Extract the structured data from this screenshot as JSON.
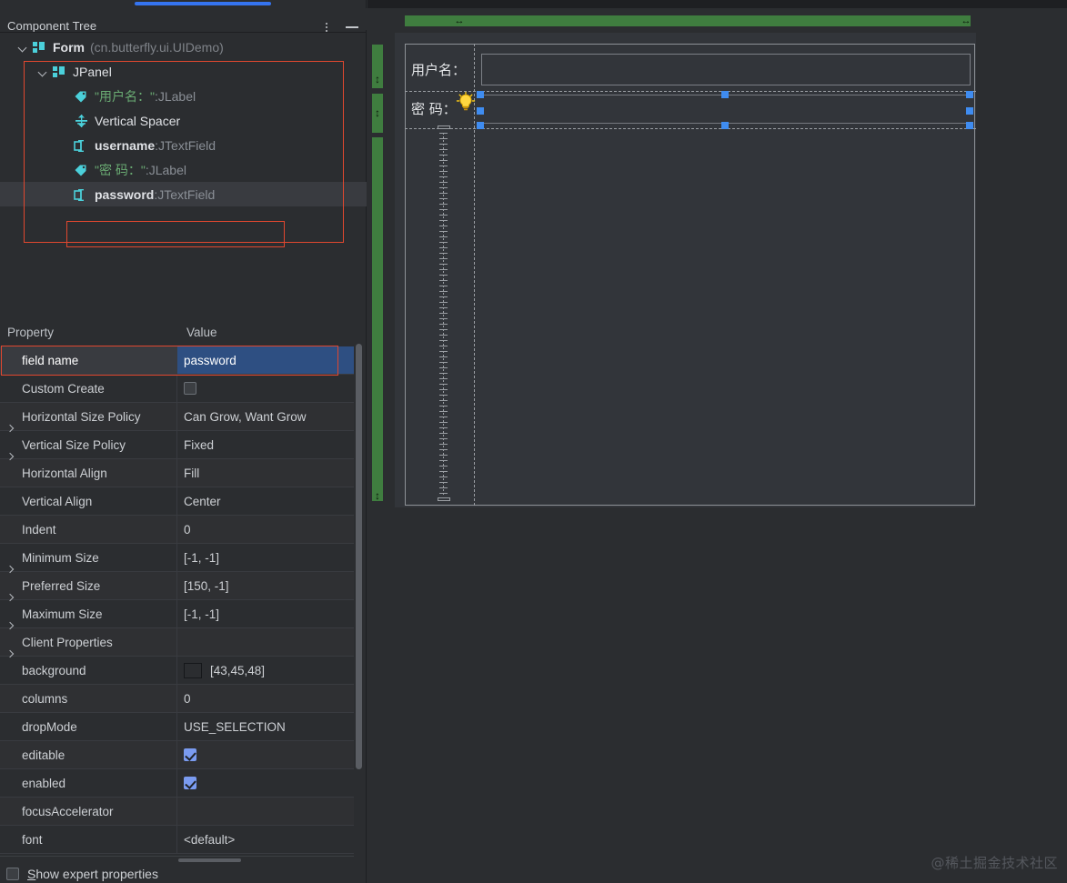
{
  "window": {
    "left_panel_title": "Component Tree",
    "kebab_icon": "more-vertical-icon",
    "minimize_icon": "minimize-icon"
  },
  "tree": {
    "nodes": [
      {
        "icon": "form-grid-icon",
        "name": "Form",
        "qualifier": "(cn.butterfly.ui.UIDemo)",
        "indent": 0,
        "expanded": true,
        "selected": false
      },
      {
        "icon": "panel-grid-icon",
        "name": "JPanel",
        "qualifier": "",
        "indent": 1,
        "expanded": true,
        "selected": false
      },
      {
        "icon": "label-tag-icon",
        "name": "\"用户名：\"",
        "separator": " : ",
        "type": "JLabel",
        "indent": 2,
        "selected": false
      },
      {
        "icon": "vertical-spacer-icon",
        "name": "Vertical Spacer",
        "separator": "",
        "type": "",
        "indent": 2,
        "selected": false
      },
      {
        "icon": "textfield-icon",
        "name": "username",
        "separator": " : ",
        "type": "JTextField",
        "indent": 2,
        "selected": false
      },
      {
        "icon": "label-tag-icon",
        "name": "\"密  码：\"",
        "separator": " : ",
        "type": "JLabel",
        "indent": 2,
        "selected": false
      },
      {
        "icon": "textfield-icon",
        "name": "password",
        "separator": " : ",
        "type": "JTextField",
        "indent": 2,
        "selected": true
      }
    ]
  },
  "properties": {
    "header": {
      "name_col": "Property",
      "value_col": "Value"
    },
    "rows": [
      {
        "name": "field name",
        "value": "password",
        "expandable": false,
        "selected": true,
        "kind": "text"
      },
      {
        "name": "Custom Create",
        "value": "",
        "expandable": false,
        "selected": false,
        "kind": "checkbox",
        "checked": false
      },
      {
        "name": "Horizontal Size Policy",
        "value": "Can Grow, Want Grow",
        "expandable": true,
        "selected": false,
        "kind": "text"
      },
      {
        "name": "Vertical Size Policy",
        "value": "Fixed",
        "expandable": true,
        "selected": false,
        "kind": "text"
      },
      {
        "name": "Horizontal Align",
        "value": "Fill",
        "expandable": false,
        "selected": false,
        "kind": "text"
      },
      {
        "name": "Vertical Align",
        "value": "Center",
        "expandable": false,
        "selected": false,
        "kind": "text"
      },
      {
        "name": "Indent",
        "value": "0",
        "expandable": false,
        "selected": false,
        "kind": "text"
      },
      {
        "name": "Minimum Size",
        "value": "[-1, -1]",
        "expandable": true,
        "selected": false,
        "kind": "text"
      },
      {
        "name": "Preferred Size",
        "value": "[150, -1]",
        "expandable": true,
        "selected": false,
        "kind": "text"
      },
      {
        "name": "Maximum Size",
        "value": "[-1, -1]",
        "expandable": true,
        "selected": false,
        "kind": "text"
      },
      {
        "name": "Client Properties",
        "value": "",
        "expandable": true,
        "selected": false,
        "kind": "text"
      },
      {
        "name": "background",
        "value": "[43,45,48]",
        "expandable": false,
        "selected": false,
        "kind": "color",
        "swatch": "#2b2d30"
      },
      {
        "name": "columns",
        "value": "0",
        "expandable": false,
        "selected": false,
        "kind": "text"
      },
      {
        "name": "dropMode",
        "value": "USE_SELECTION",
        "expandable": false,
        "selected": false,
        "kind": "text"
      },
      {
        "name": "editable",
        "value": "",
        "expandable": false,
        "selected": false,
        "kind": "checkbox",
        "checked": true
      },
      {
        "name": "enabled",
        "value": "",
        "expandable": false,
        "selected": false,
        "kind": "checkbox",
        "checked": true
      },
      {
        "name": "focusAccelerator",
        "value": "",
        "expandable": false,
        "selected": false,
        "kind": "text"
      },
      {
        "name": "font",
        "value": "<default>",
        "expandable": false,
        "selected": false,
        "kind": "text"
      }
    ],
    "expert_toggle": {
      "label_prefix": "S",
      "label_rest": "how expert properties",
      "checked": false
    }
  },
  "designer": {
    "username_label": "用户名：",
    "password_label": "密  码：",
    "username_value": "",
    "password_value": "",
    "bulb_icon": "lightbulb-intention-icon",
    "gutter_arrow_h": "↔",
    "gutter_arrow_v": "↕"
  },
  "watermark": {
    "text": "@稀土掘金技术社区"
  }
}
